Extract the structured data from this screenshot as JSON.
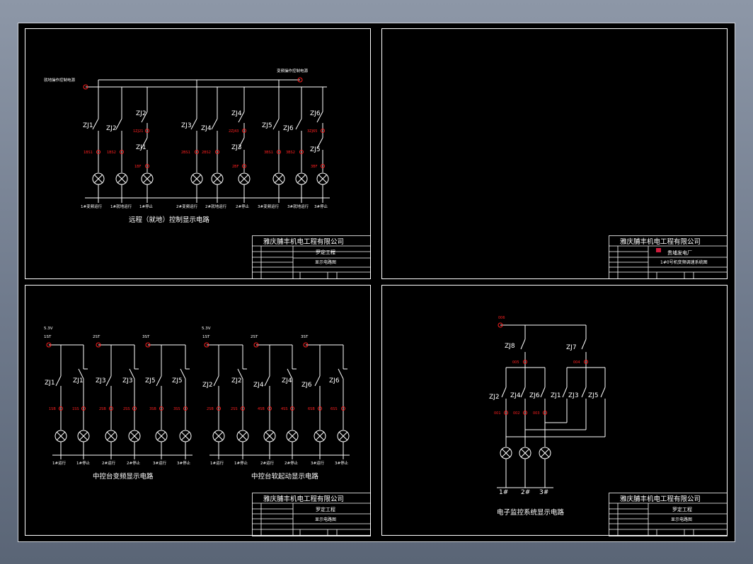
{
  "colors": {
    "background": "#000000",
    "line": "#ffffff",
    "node": "#ff2020",
    "frame_outer": "#ffffff"
  },
  "company": "雅庆脯丰机电工程有限公司",
  "sheet_tl": {
    "caption": "远程（就地）控制显示电路",
    "tb_project": "罗定工程",
    "tb_drawing": "显示电路图",
    "sources": [
      "就地操作控制电源",
      "变频操作控制电源"
    ],
    "relays": [
      "ZJ1",
      "ZJ2",
      "ZJ2",
      "ZJ1",
      "ZJ3",
      "ZJ4",
      "ZJ4",
      "ZJ3",
      "ZJ5",
      "ZJ6",
      "ZJ6",
      "ZJ5"
    ],
    "node_labels": [
      "1BS1",
      "1BS2",
      "1ZJ21",
      "1BF",
      "2BS1",
      "2BS2",
      "2ZJ43",
      "2BF",
      "3BS1",
      "3BS2",
      "3ZJ65",
      "3BF"
    ],
    "bottom_labels": [
      "1#变频运行",
      "1#就地运行",
      "1#停止",
      "2#变频运行",
      "2#就地运行",
      "2#停止",
      "3#变频运行",
      "3#就地运行",
      "3#停止"
    ]
  },
  "sheet_tr": {
    "tb_project": "贵埔发电厂",
    "tb_drawing": "1#0号机变频调速系统图"
  },
  "sheet_bl": {
    "caption_left": "中控台变频显示电路",
    "caption_right": "中控台软起动显示电路",
    "tb_project": "罗定工程",
    "tb_drawing": "显示电路图",
    "voltage": "5.3V",
    "top_nodes_left": [
      "1ST",
      "2ST",
      "3ST"
    ],
    "top_nodes_right": [
      "1ST",
      "2ST",
      "3ST"
    ],
    "relays_left": [
      "ZJ1",
      "ZJ1",
      "ZJ3",
      "ZJ3",
      "ZJ5",
      "ZJ5"
    ],
    "relays_right": [
      "ZJ2",
      "ZJ2",
      "ZJ4",
      "ZJ4",
      "ZJ6",
      "ZJ6"
    ],
    "nodes_left": [
      "1SB",
      "1SS",
      "2SB",
      "2SS",
      "3SB",
      "3SS"
    ],
    "nodes_right": [
      "2SB",
      "2SS",
      "4SB",
      "4SS",
      "6SB",
      "6SS"
    ],
    "bottom_left": [
      "1#运行",
      "1#停止",
      "2#运行",
      "2#停止",
      "3#运行",
      "3#停止"
    ],
    "bottom_right": [
      "1#运行",
      "1#停止",
      "2#运行",
      "2#停止",
      "3#运行",
      "3#停止"
    ]
  },
  "sheet_br": {
    "caption": "电子监控系统显示电路",
    "tb_project": "罗定工程",
    "tb_drawing": "显示电路图",
    "top_node": "006",
    "upper_relays": [
      "ZJ8",
      "ZJ7"
    ],
    "upper_nodes": [
      "005",
      "004"
    ],
    "lower_relays": [
      "ZJ2",
      "ZJ4",
      "ZJ6",
      "ZJ1",
      "ZJ3",
      "ZJ5"
    ],
    "lower_nodes": [
      "001",
      "002",
      "003"
    ],
    "bus_labels": [
      "1#",
      "2#",
      "3#"
    ]
  }
}
